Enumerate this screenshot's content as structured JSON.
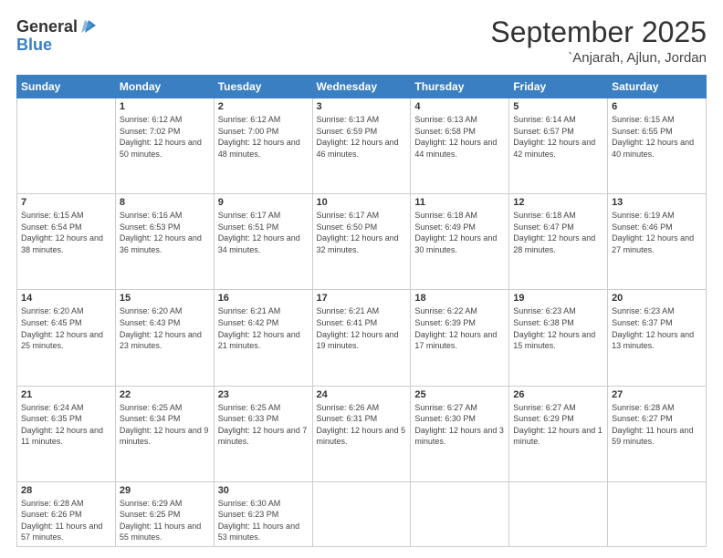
{
  "logo": {
    "general": "General",
    "blue": "Blue"
  },
  "header": {
    "month": "September 2025",
    "location": "`Anjarah, Ajlun, Jordan"
  },
  "weekdays": [
    "Sunday",
    "Monday",
    "Tuesday",
    "Wednesday",
    "Thursday",
    "Friday",
    "Saturday"
  ],
  "weeks": [
    [
      {
        "day": "",
        "sunrise": "",
        "sunset": "",
        "daylight": ""
      },
      {
        "day": "1",
        "sunrise": "Sunrise: 6:12 AM",
        "sunset": "Sunset: 7:02 PM",
        "daylight": "Daylight: 12 hours and 50 minutes."
      },
      {
        "day": "2",
        "sunrise": "Sunrise: 6:12 AM",
        "sunset": "Sunset: 7:00 PM",
        "daylight": "Daylight: 12 hours and 48 minutes."
      },
      {
        "day": "3",
        "sunrise": "Sunrise: 6:13 AM",
        "sunset": "Sunset: 6:59 PM",
        "daylight": "Daylight: 12 hours and 46 minutes."
      },
      {
        "day": "4",
        "sunrise": "Sunrise: 6:13 AM",
        "sunset": "Sunset: 6:58 PM",
        "daylight": "Daylight: 12 hours and 44 minutes."
      },
      {
        "day": "5",
        "sunrise": "Sunrise: 6:14 AM",
        "sunset": "Sunset: 6:57 PM",
        "daylight": "Daylight: 12 hours and 42 minutes."
      },
      {
        "day": "6",
        "sunrise": "Sunrise: 6:15 AM",
        "sunset": "Sunset: 6:55 PM",
        "daylight": "Daylight: 12 hours and 40 minutes."
      }
    ],
    [
      {
        "day": "7",
        "sunrise": "Sunrise: 6:15 AM",
        "sunset": "Sunset: 6:54 PM",
        "daylight": "Daylight: 12 hours and 38 minutes."
      },
      {
        "day": "8",
        "sunrise": "Sunrise: 6:16 AM",
        "sunset": "Sunset: 6:53 PM",
        "daylight": "Daylight: 12 hours and 36 minutes."
      },
      {
        "day": "9",
        "sunrise": "Sunrise: 6:17 AM",
        "sunset": "Sunset: 6:51 PM",
        "daylight": "Daylight: 12 hours and 34 minutes."
      },
      {
        "day": "10",
        "sunrise": "Sunrise: 6:17 AM",
        "sunset": "Sunset: 6:50 PM",
        "daylight": "Daylight: 12 hours and 32 minutes."
      },
      {
        "day": "11",
        "sunrise": "Sunrise: 6:18 AM",
        "sunset": "Sunset: 6:49 PM",
        "daylight": "Daylight: 12 hours and 30 minutes."
      },
      {
        "day": "12",
        "sunrise": "Sunrise: 6:18 AM",
        "sunset": "Sunset: 6:47 PM",
        "daylight": "Daylight: 12 hours and 28 minutes."
      },
      {
        "day": "13",
        "sunrise": "Sunrise: 6:19 AM",
        "sunset": "Sunset: 6:46 PM",
        "daylight": "Daylight: 12 hours and 27 minutes."
      }
    ],
    [
      {
        "day": "14",
        "sunrise": "Sunrise: 6:20 AM",
        "sunset": "Sunset: 6:45 PM",
        "daylight": "Daylight: 12 hours and 25 minutes."
      },
      {
        "day": "15",
        "sunrise": "Sunrise: 6:20 AM",
        "sunset": "Sunset: 6:43 PM",
        "daylight": "Daylight: 12 hours and 23 minutes."
      },
      {
        "day": "16",
        "sunrise": "Sunrise: 6:21 AM",
        "sunset": "Sunset: 6:42 PM",
        "daylight": "Daylight: 12 hours and 21 minutes."
      },
      {
        "day": "17",
        "sunrise": "Sunrise: 6:21 AM",
        "sunset": "Sunset: 6:41 PM",
        "daylight": "Daylight: 12 hours and 19 minutes."
      },
      {
        "day": "18",
        "sunrise": "Sunrise: 6:22 AM",
        "sunset": "Sunset: 6:39 PM",
        "daylight": "Daylight: 12 hours and 17 minutes."
      },
      {
        "day": "19",
        "sunrise": "Sunrise: 6:23 AM",
        "sunset": "Sunset: 6:38 PM",
        "daylight": "Daylight: 12 hours and 15 minutes."
      },
      {
        "day": "20",
        "sunrise": "Sunrise: 6:23 AM",
        "sunset": "Sunset: 6:37 PM",
        "daylight": "Daylight: 12 hours and 13 minutes."
      }
    ],
    [
      {
        "day": "21",
        "sunrise": "Sunrise: 6:24 AM",
        "sunset": "Sunset: 6:35 PM",
        "daylight": "Daylight: 12 hours and 11 minutes."
      },
      {
        "day": "22",
        "sunrise": "Sunrise: 6:25 AM",
        "sunset": "Sunset: 6:34 PM",
        "daylight": "Daylight: 12 hours and 9 minutes."
      },
      {
        "day": "23",
        "sunrise": "Sunrise: 6:25 AM",
        "sunset": "Sunset: 6:33 PM",
        "daylight": "Daylight: 12 hours and 7 minutes."
      },
      {
        "day": "24",
        "sunrise": "Sunrise: 6:26 AM",
        "sunset": "Sunset: 6:31 PM",
        "daylight": "Daylight: 12 hours and 5 minutes."
      },
      {
        "day": "25",
        "sunrise": "Sunrise: 6:27 AM",
        "sunset": "Sunset: 6:30 PM",
        "daylight": "Daylight: 12 hours and 3 minutes."
      },
      {
        "day": "26",
        "sunrise": "Sunrise: 6:27 AM",
        "sunset": "Sunset: 6:29 PM",
        "daylight": "Daylight: 12 hours and 1 minute."
      },
      {
        "day": "27",
        "sunrise": "Sunrise: 6:28 AM",
        "sunset": "Sunset: 6:27 PM",
        "daylight": "Daylight: 11 hours and 59 minutes."
      }
    ],
    [
      {
        "day": "28",
        "sunrise": "Sunrise: 6:28 AM",
        "sunset": "Sunset: 6:26 PM",
        "daylight": "Daylight: 11 hours and 57 minutes."
      },
      {
        "day": "29",
        "sunrise": "Sunrise: 6:29 AM",
        "sunset": "Sunset: 6:25 PM",
        "daylight": "Daylight: 11 hours and 55 minutes."
      },
      {
        "day": "30",
        "sunrise": "Sunrise: 6:30 AM",
        "sunset": "Sunset: 6:23 PM",
        "daylight": "Daylight: 11 hours and 53 minutes."
      },
      {
        "day": "",
        "sunrise": "",
        "sunset": "",
        "daylight": ""
      },
      {
        "day": "",
        "sunrise": "",
        "sunset": "",
        "daylight": ""
      },
      {
        "day": "",
        "sunrise": "",
        "sunset": "",
        "daylight": ""
      },
      {
        "day": "",
        "sunrise": "",
        "sunset": "",
        "daylight": ""
      }
    ]
  ]
}
